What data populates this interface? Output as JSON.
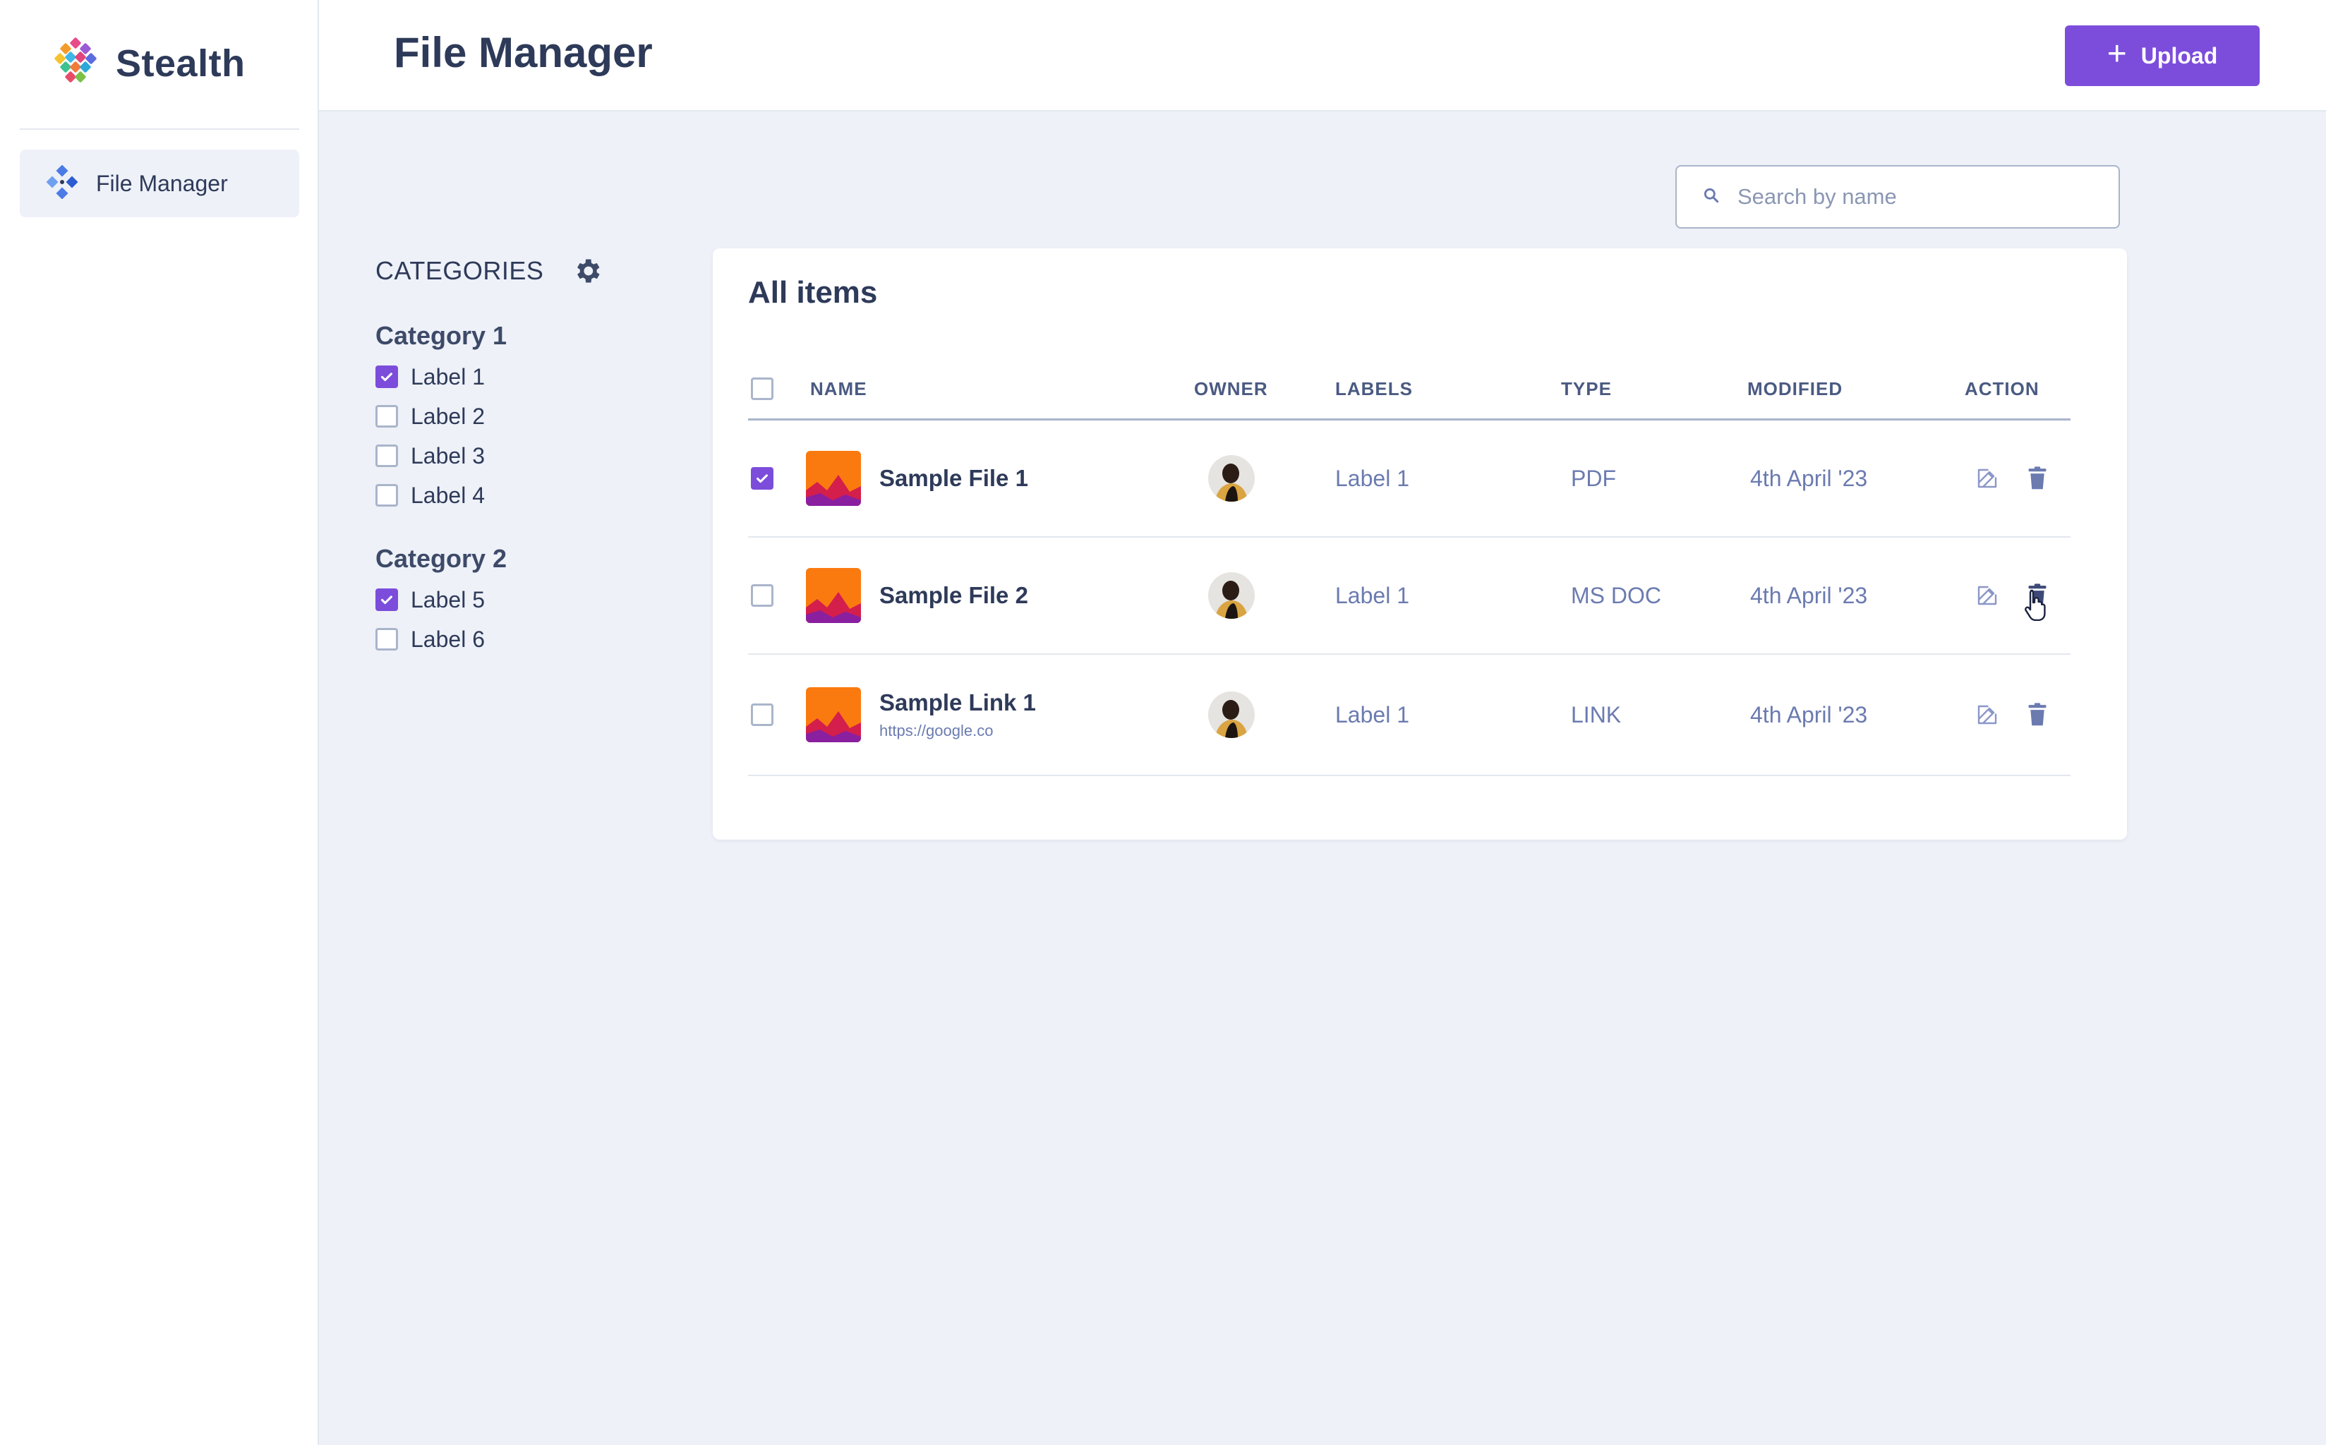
{
  "app": {
    "brand": "Stealth",
    "colors": {
      "accent": "#7c4ddb",
      "text": "#2e3a59",
      "muted": "#6b7bb0",
      "bg": "#eef1f8"
    }
  },
  "sidebar": {
    "items": [
      {
        "label": "File Manager",
        "icon": "grid-diamond-icon",
        "active": true
      }
    ]
  },
  "header": {
    "title": "File Manager",
    "upload_label": "Upload"
  },
  "search": {
    "placeholder": "Search by name",
    "value": ""
  },
  "categories": {
    "title": "CATEGORIES",
    "groups": [
      {
        "title": "Category 1",
        "labels": [
          {
            "text": "Label 1",
            "checked": true
          },
          {
            "text": "Label 2",
            "checked": false
          },
          {
            "text": "Label 3",
            "checked": false
          },
          {
            "text": "Label 4",
            "checked": false
          }
        ]
      },
      {
        "title": "Category 2",
        "labels": [
          {
            "text": "Label 5",
            "checked": true
          },
          {
            "text": "Label 6",
            "checked": false
          }
        ]
      }
    ]
  },
  "table": {
    "title": "All items",
    "headers": {
      "name": "NAME",
      "owner": "OWNER",
      "labels": "LABELS",
      "type": "TYPE",
      "modified": "MODIFIED",
      "action": "ACTION"
    },
    "rows": [
      {
        "name": "Sample File 1",
        "sub": "",
        "label": "Label 1",
        "type": "PDF",
        "modified": "4th April '23",
        "checked": true
      },
      {
        "name": "Sample File 2",
        "sub": "",
        "label": "Label 1",
        "type": "MS DOC",
        "modified": "4th April '23",
        "checked": false
      },
      {
        "name": "Sample Link 1",
        "sub": "https://google.co",
        "label": "Label 1",
        "type": "LINK",
        "modified": "4th April '23",
        "checked": false
      }
    ]
  }
}
